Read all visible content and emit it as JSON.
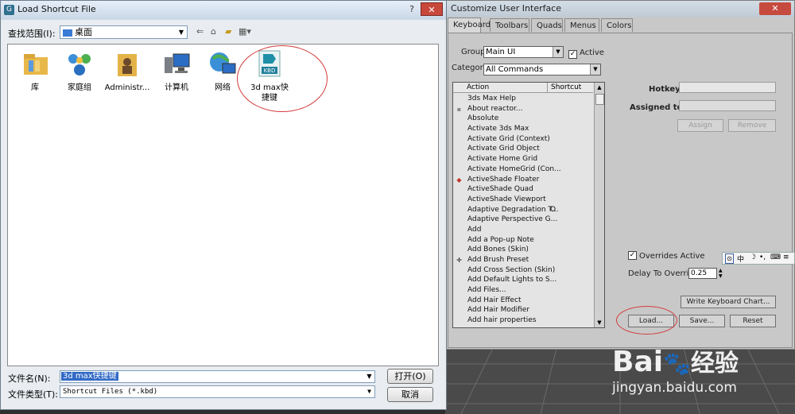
{
  "load_dialog": {
    "title": "Load Shortcut File",
    "help": "?",
    "close": "✕",
    "look_in_label": "查找范围(I):",
    "look_in_value": "桌面",
    "files": [
      {
        "name": "库",
        "icon": "library-icon"
      },
      {
        "name": "家庭组",
        "icon": "homegroup-icon"
      },
      {
        "name": "Administr...",
        "icon": "user-folder-icon"
      },
      {
        "name": "计算机",
        "icon": "computer-icon"
      },
      {
        "name": "网络",
        "icon": "network-icon"
      },
      {
        "name": "3d max快捷键",
        "icon": "kbd-file-icon",
        "badge": "KBD"
      }
    ],
    "filename_label": "文件名(N):",
    "filename_value": "3d max快捷键",
    "filetype_label": "文件类型(T):",
    "filetype_value": "Shortcut Files (*.kbd)",
    "open_button": "打开(O)",
    "cancel_button": "取消"
  },
  "cui": {
    "title": "Customize User Interface",
    "tabs": [
      "Keyboard",
      "Toolbars",
      "Quads",
      "Menus",
      "Colors"
    ],
    "group_label": "Group",
    "group_value": "Main UI",
    "active_label": "Active",
    "category_label": "Category",
    "category_value": "All Commands",
    "columns": [
      "Action",
      "Shortcut"
    ],
    "actions": [
      {
        "name": "3ds Max Help",
        "shortcut": ""
      },
      {
        "name": "About reactor...",
        "shortcut": ""
      },
      {
        "name": "Absolute",
        "shortcut": ""
      },
      {
        "name": "Activate 3ds Max",
        "shortcut": ""
      },
      {
        "name": "Activate Grid (Context)",
        "shortcut": ""
      },
      {
        "name": "Activate Grid Object",
        "shortcut": ""
      },
      {
        "name": "Activate Home Grid",
        "shortcut": ""
      },
      {
        "name": "Activate HomeGrid (Con...",
        "shortcut": ""
      },
      {
        "name": "ActiveShade Floater",
        "shortcut": ""
      },
      {
        "name": "ActiveShade Quad",
        "shortcut": ""
      },
      {
        "name": "ActiveShade Viewport",
        "shortcut": ""
      },
      {
        "name": "Adaptive Degradation T...",
        "shortcut": "O"
      },
      {
        "name": "Adaptive Perspective G...",
        "shortcut": ""
      },
      {
        "name": "Add",
        "shortcut": ""
      },
      {
        "name": "Add a Pop-up Note",
        "shortcut": ""
      },
      {
        "name": "Add Bones (Skin)",
        "shortcut": ""
      },
      {
        "name": "Add Brush Preset",
        "shortcut": ""
      },
      {
        "name": "Add Cross Section (Skin)",
        "shortcut": ""
      },
      {
        "name": "Add Default Lights to S...",
        "shortcut": ""
      },
      {
        "name": "Add Files...",
        "shortcut": ""
      },
      {
        "name": "Add Hair Effect",
        "shortcut": ""
      },
      {
        "name": "Add Hair Modifier",
        "shortcut": ""
      },
      {
        "name": "Add hair properties",
        "shortcut": ""
      }
    ],
    "hotkey_label": "Hotkey:",
    "assigned_label": "Assigned to:",
    "assign_button": "Assign",
    "remove_button": "Remove",
    "overrides_label": "Overrides Active",
    "delay_label": "Delay To Override",
    "delay_value": "0.25",
    "write_chart_button": "Write Keyboard Chart...",
    "load_button": "Load...",
    "save_button": "Save...",
    "reset_button": "Reset"
  },
  "ime": {
    "mode": "中"
  },
  "watermark": {
    "brand": "Bai",
    "brand_cn": "经验",
    "url": "jingyan.baidu.com"
  }
}
